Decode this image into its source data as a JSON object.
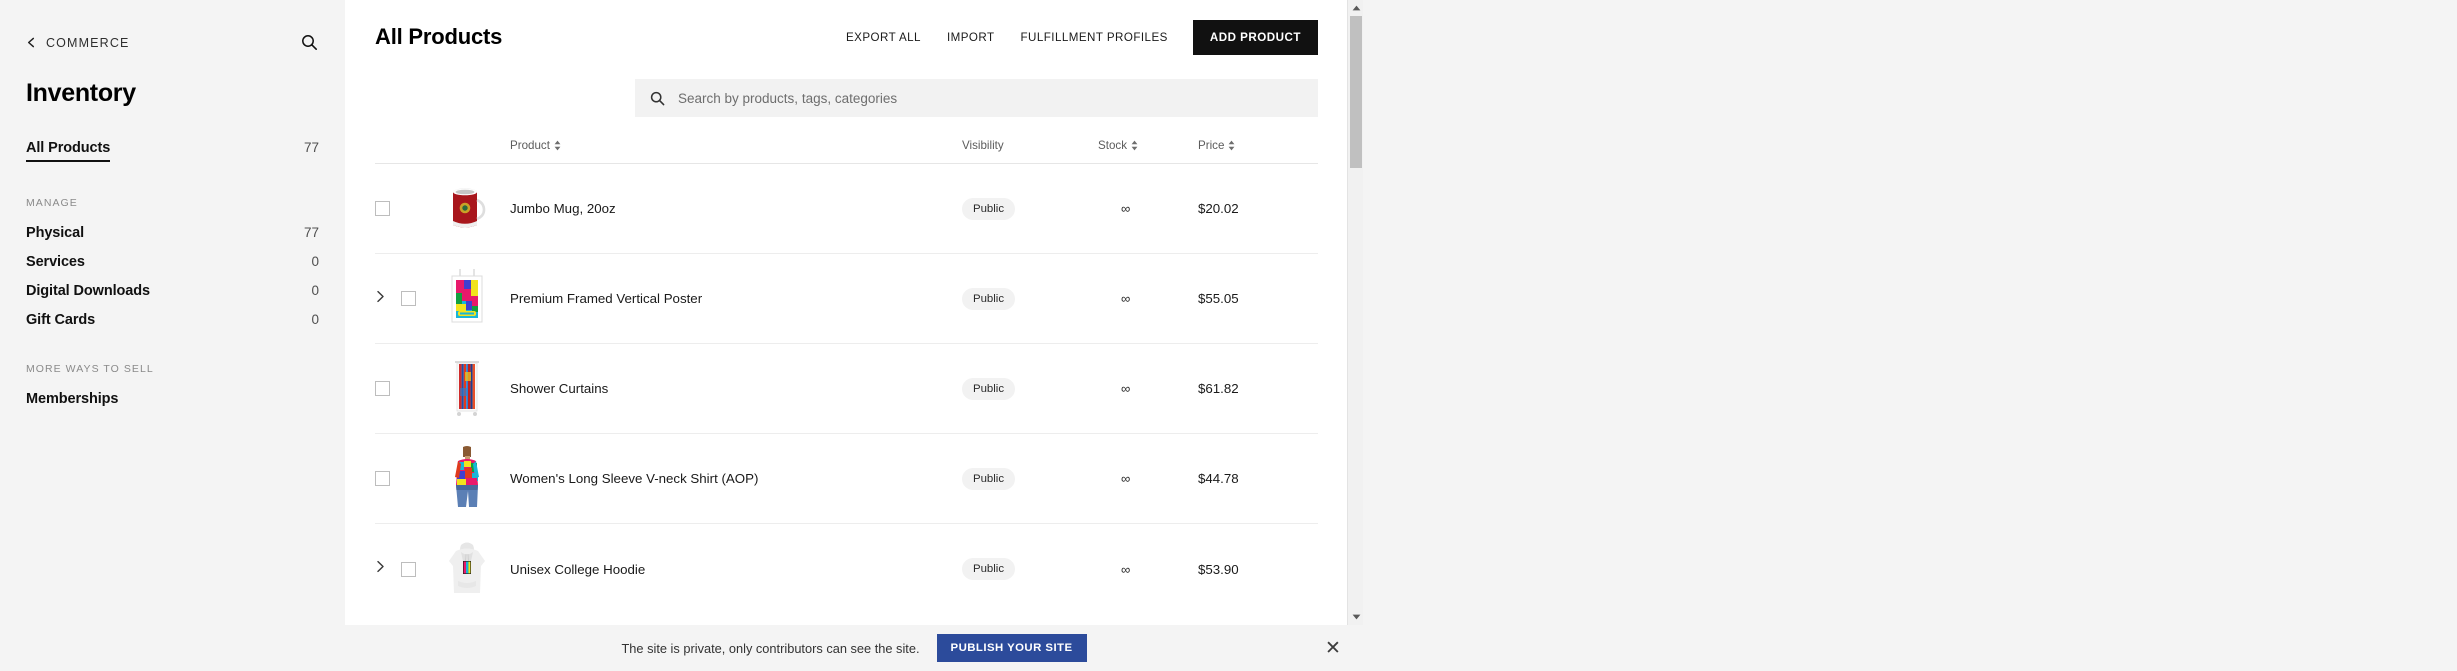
{
  "sidebar": {
    "back_label": "COMMERCE",
    "back_icon": "chevron-left-icon",
    "search_icon": "search-icon",
    "title": "Inventory",
    "primary": {
      "label": "All Products",
      "count": "77",
      "active": true
    },
    "sections": [
      {
        "heading": "MANAGE",
        "items": [
          {
            "label": "Physical",
            "count": "77"
          },
          {
            "label": "Services",
            "count": "0"
          },
          {
            "label": "Digital Downloads",
            "count": "0"
          },
          {
            "label": "Gift Cards",
            "count": "0"
          }
        ]
      },
      {
        "heading": "MORE WAYS TO SELL",
        "items": [
          {
            "label": "Memberships",
            "count": ""
          }
        ]
      }
    ]
  },
  "header": {
    "title": "All Products",
    "actions": [
      {
        "label": "EXPORT ALL",
        "style": "link"
      },
      {
        "label": "IMPORT",
        "style": "link"
      },
      {
        "label": "FULFILLMENT PROFILES",
        "style": "link"
      },
      {
        "label": "ADD PRODUCT",
        "style": "primary"
      }
    ]
  },
  "search": {
    "icon": "search-icon",
    "value": "",
    "placeholder": "Search by products, tags, categories"
  },
  "table": {
    "columns": [
      {
        "key": "product",
        "label": "Product",
        "sortable": true
      },
      {
        "key": "visibility",
        "label": "Visibility",
        "sortable": false
      },
      {
        "key": "stock",
        "label": "Stock",
        "sortable": true
      },
      {
        "key": "price",
        "label": "Price",
        "sortable": true
      }
    ],
    "rows": [
      {
        "name": "Jumbo Mug, 20oz",
        "visibility": "Public",
        "stock": "∞",
        "price": "$20.02",
        "expandable": false,
        "selected": false,
        "thumb": "mug-red"
      },
      {
        "name": "Premium Framed Vertical Poster",
        "visibility": "Public",
        "stock": "∞",
        "price": "$55.05",
        "expandable": true,
        "selected": false,
        "thumb": "framed-poster"
      },
      {
        "name": "Shower Curtains",
        "visibility": "Public",
        "stock": "∞",
        "price": "$61.82",
        "expandable": false,
        "selected": false,
        "thumb": "shower-curtain"
      },
      {
        "name": "Women's Long Sleeve V-neck Shirt (AOP)",
        "visibility": "Public",
        "stock": "∞",
        "price": "$44.78",
        "expandable": false,
        "selected": false,
        "thumb": "model-shirt"
      },
      {
        "name": "Unisex College Hoodie",
        "visibility": "Public",
        "stock": "∞",
        "price": "$53.90",
        "expandable": true,
        "selected": false,
        "thumb": "hoodie-gray"
      }
    ]
  },
  "banner": {
    "message": "The site is private, only contributors can see the site.",
    "button_label": "PUBLISH YOUR SITE",
    "close_icon": "close-icon",
    "button_color": "#2c4b9b"
  },
  "scrollbar": {
    "up_icon": "caret-up-icon",
    "down_icon": "caret-down-icon"
  },
  "colors": {
    "page_background": "#f4f4f4",
    "panel_background": "#ffffff",
    "accent_primary": "#111111",
    "publish_blue": "#2c4b9b",
    "badge_background": "#f2f2f2"
  }
}
